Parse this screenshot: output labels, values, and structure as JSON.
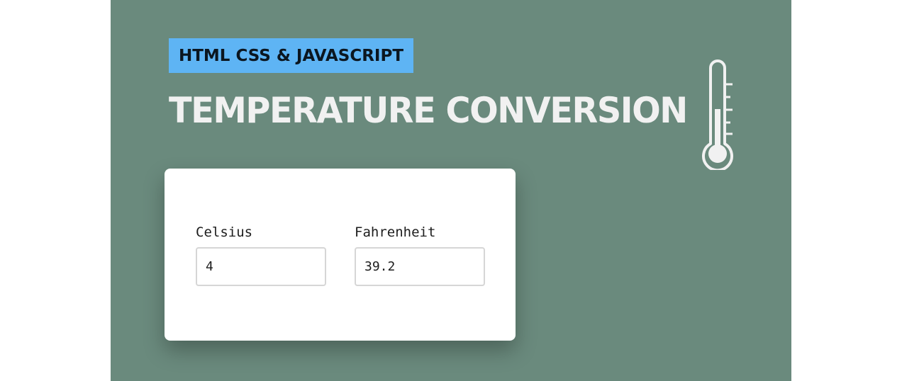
{
  "banner": {
    "tag": "HTML CSS & JAVASCRIPT",
    "title": "TEMPERATURE CONVERSION"
  },
  "converter": {
    "celsius_label": "Celsius",
    "celsius_value": "4",
    "fahrenheit_label": "Fahrenheit",
    "fahrenheit_value": "39.2"
  },
  "colors": {
    "background": "#6a8a7d",
    "tag_background": "#5eb4f4",
    "title_text": "#f1f1f1",
    "card_background": "#ffffff"
  },
  "icons": {
    "thermometer": "thermometer-icon"
  }
}
